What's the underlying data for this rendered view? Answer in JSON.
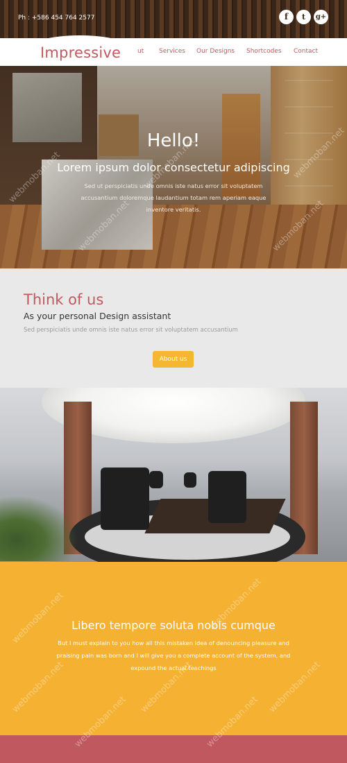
{
  "topbar": {
    "phone": "Ph : +586 454 764 2577",
    "social": [
      {
        "icon": "facebook-icon",
        "glyph": "f"
      },
      {
        "icon": "twitter-icon",
        "glyph": "t"
      },
      {
        "icon": "google-plus-icon",
        "glyph": "g+"
      }
    ]
  },
  "nav": {
    "logo": "Impressive",
    "items": [
      "ut",
      "Services",
      "Our Designs",
      "Shortcodes",
      "Contact"
    ]
  },
  "hero": {
    "title": "Hello!",
    "subtitle": "Lorem ipsum dolor consectetur adipiscing",
    "text": "Sed ut perspiciatis unde omnis iste natus error sit voluptatem accusantium doloremque laudantium totam rem aperiam eaque inventore veritatis."
  },
  "think": {
    "title": "Think of us",
    "subtitle": "As your personal Design assistant",
    "text": "Sed perspiciatis unde omnis iste natus error sit voluptatem accusantium",
    "button": "About us"
  },
  "libero": {
    "title": "Libero tempore soluta nobis cumque",
    "text": "But I must explain to you how all this mistaken idea of denouncing pleasure and praising pain was born and I will give you a complete account of the system, and expound the actual teachings"
  },
  "watermark": "webmoban.net",
  "colors": {
    "accent": "#c0595f",
    "button": "#f5b731",
    "section_yellow": "#f5b131",
    "section_grey": "#e9e9e9"
  }
}
